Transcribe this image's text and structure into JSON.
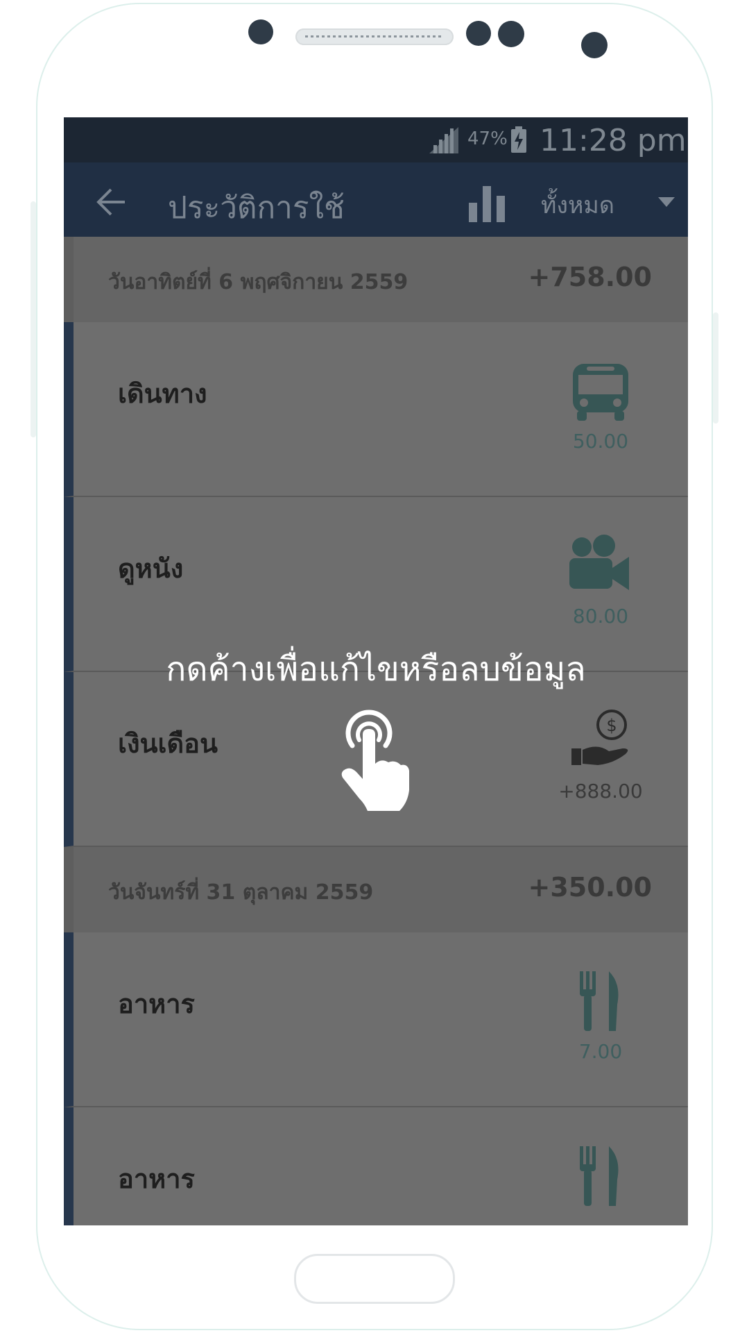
{
  "status_bar": {
    "battery_percent": "47%",
    "time": "11:28 pm"
  },
  "app_bar": {
    "title": "ประวัติการใช้",
    "filter_label": "ทั้งหมด",
    "back_icon": "arrow-left-icon",
    "chart_icon": "bar-chart-icon",
    "dropdown_icon": "triangle-down-icon"
  },
  "groups": [
    {
      "date": "วันอาทิตย์ที่ 6 พฤศจิกายน 2559",
      "total": "+758.00",
      "entries": [
        {
          "title": "เดินทาง",
          "amount": "50.00",
          "icon": "bus-icon"
        },
        {
          "title": "ดูหนัง",
          "amount": "80.00",
          "icon": "movie-camera-icon"
        },
        {
          "title": "เงินเดือน",
          "amount": "+888.00",
          "icon": "money-hand-icon"
        }
      ]
    },
    {
      "date": "วันจันทร์ที่ 31 ตุลาคม 2559",
      "total": "+350.00",
      "entries": [
        {
          "title": "อาหาร",
          "amount": "7.00",
          "icon": "fork-knife-icon"
        },
        {
          "title": "อาหาร",
          "amount": "",
          "icon": "fork-knife-icon"
        }
      ]
    }
  ],
  "hint": {
    "text": "กดค้างเพื่อแก้ไขหรือลบข้อมูล",
    "icon": "tap-hand-icon"
  },
  "colors": {
    "status_bar": "#1c2633",
    "app_bar": "#202f44",
    "entry_accent": "#27374d",
    "icon_teal": "#375655"
  }
}
